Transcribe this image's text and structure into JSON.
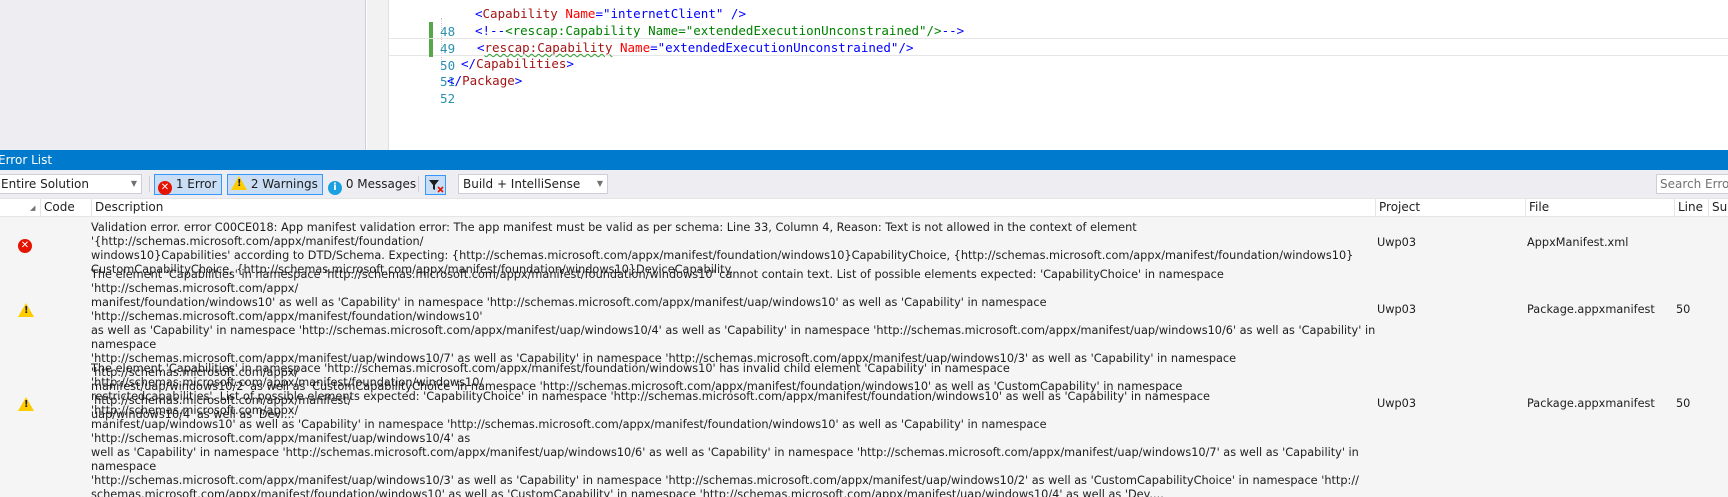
{
  "editor": {
    "lines": [
      {
        "num": "48",
        "parts": [
          [
            "b",
            "<"
          ],
          [
            "t",
            "Capability"
          ],
          [
            "s",
            " "
          ],
          [
            "a",
            "Name"
          ],
          [
            "b",
            "="
          ],
          [
            "v",
            "\"internetClient\""
          ],
          [
            "s",
            " "
          ],
          [
            "b",
            "/>"
          ]
        ]
      },
      {
        "num": "49",
        "parts": [
          [
            "b",
            "<!--"
          ],
          [
            "c",
            "<rescap:Capability Name=\"extendedExecutionUnconstrained\"/>"
          ],
          [
            "b",
            "-->"
          ]
        ]
      },
      {
        "num": "50",
        "parts": [
          [
            "b",
            "<"
          ],
          [
            "t",
            "rescap:Capability"
          ],
          [
            "s",
            " "
          ],
          [
            "a",
            "Name"
          ],
          [
            "b",
            "="
          ],
          [
            "v",
            "\"extendedExecutionUnconstrained\""
          ],
          [
            "b",
            "/>"
          ]
        ]
      },
      {
        "num": "51",
        "parts": [
          [
            "b",
            "</"
          ],
          [
            "t",
            "Capabilities"
          ],
          [
            "b",
            ">"
          ]
        ]
      },
      {
        "num": "52",
        "parts": [
          [
            "b",
            "</"
          ],
          [
            "t",
            "Package"
          ],
          [
            "b",
            ">"
          ]
        ]
      }
    ]
  },
  "error_list": {
    "title": "Error List",
    "toolbar": {
      "scope": "Entire Solution",
      "errors_label": "1 Error",
      "warnings_label": "2 Warnings",
      "messages_label": "0 Messages",
      "build_filter": "Build + IntelliSense",
      "search_placeholder": "Search Error List"
    },
    "columns": {
      "code": "Code",
      "description": "Description",
      "project": "Project",
      "file": "File",
      "line": "Line",
      "suppression": "Su"
    },
    "rows": [
      {
        "severity": "error",
        "description": "Validation error. error C00CE018: App manifest validation error: The app manifest must be valid as per schema: Line 33, Column 4, Reason: Text is not allowed in the context of element '{http://schemas.microsoft.com/appx/manifest/foundation/\nwindows10}Capabilities' according to DTD/Schema. Expecting: {http://schemas.microsoft.com/appx/manifest/foundation/windows10}CapabilityChoice, {http://schemas.microsoft.com/appx/manifest/foundation/windows10}\nCustomCapabilityChoice, {http://schemas.microsoft.com/appx/manifest/foundation/windows10}DeviceCapability.",
        "project": "Uwp03",
        "file": "AppxManifest.xml",
        "line": ""
      },
      {
        "severity": "warning",
        "description": "The element 'Capabilities' in namespace 'http://schemas.microsoft.com/appx/manifest/foundation/windows10' cannot contain text. List of possible elements expected: 'CapabilityChoice' in namespace 'http://schemas.microsoft.com/appx/\nmanifest/foundation/windows10' as well as 'Capability' in namespace 'http://schemas.microsoft.com/appx/manifest/uap/windows10' as well as 'Capability' in namespace 'http://schemas.microsoft.com/appx/manifest/foundation/windows10'\nas well as 'Capability' in namespace 'http://schemas.microsoft.com/appx/manifest/uap/windows10/4' as well as 'Capability' in namespace 'http://schemas.microsoft.com/appx/manifest/uap/windows10/6' as well as 'Capability' in namespace\n'http://schemas.microsoft.com/appx/manifest/uap/windows10/7' as well as 'Capability' in namespace 'http://schemas.microsoft.com/appx/manifest/uap/windows10/3' as well as 'Capability' in namespace 'http://schemas.microsoft.com/appx/\nmanifest/uap/windows10/2' as well as 'CustomCapabilityChoice' in namespace 'http://schemas.microsoft.com/appx/manifest/foundation/windows10' as well as 'CustomCapability' in namespace 'http://schemas.microsoft.com/appx/manifest/\nuap/windows10/4' as well as 'Dev....",
        "project": "Uwp03",
        "file": "Package.appxmanifest",
        "line": "50"
      },
      {
        "severity": "warning",
        "description": "The element 'Capabilities' in namespace 'http://schemas.microsoft.com/appx/manifest/foundation/windows10' has invalid child element 'Capability' in namespace 'http://schemas.microsoft.com/appx/manifest/foundation/windows10/\nrestrictedcapabilities'. List of possible elements expected: 'CapabilityChoice' in namespace 'http://schemas.microsoft.com/appx/manifest/foundation/windows10' as well as 'Capability' in namespace 'http://schemas.microsoft.com/appx/\nmanifest/uap/windows10' as well as 'Capability' in namespace 'http://schemas.microsoft.com/appx/manifest/foundation/windows10' as well as 'Capability' in namespace 'http://schemas.microsoft.com/appx/manifest/uap/windows10/4' as\nwell as 'Capability' in namespace 'http://schemas.microsoft.com/appx/manifest/uap/windows10/6' as well as 'Capability' in namespace 'http://schemas.microsoft.com/appx/manifest/uap/windows10/7' as well as 'Capability' in namespace\n'http://schemas.microsoft.com/appx/manifest/uap/windows10/3' as well as 'Capability' in namespace 'http://schemas.microsoft.com/appx/manifest/uap/windows10/2' as well as 'CustomCapabilityChoice' in namespace 'http://\nschemas.microsoft.com/appx/manifest/foundation/windows10' as well as 'CustomCapability' in namespace 'http://schemas.microsoft.com/appx/manifest/uap/windows10/4' as well as 'Dev....",
        "project": "Uwp03",
        "file": "Package.appxmanifest",
        "line": "50"
      }
    ]
  },
  "colors": {
    "title_bar": "#007acc",
    "error_icon": "#e51400",
    "warning_icon": "#ffcc00",
    "info_icon": "#1ba1e2",
    "line_number": "#2b91af"
  }
}
